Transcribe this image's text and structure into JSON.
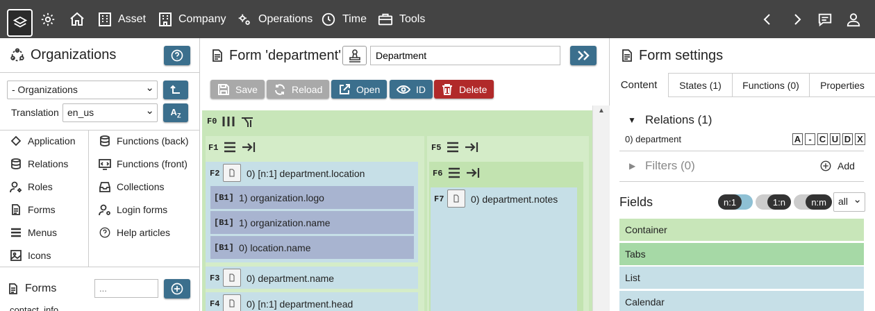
{
  "topbar": {
    "asset": "Asset",
    "company": "Company",
    "operations": "Operations",
    "time": "Time",
    "tools": "Tools"
  },
  "left": {
    "title": "Organizations",
    "select_value": "- Organizations",
    "translation_label": "Translation",
    "translation_value": "en_us",
    "menu_col1": [
      "Application",
      "Relations",
      "Roles",
      "Forms",
      "Menus",
      "Icons"
    ],
    "menu_col2": [
      "Functions (back)",
      "Functions (front)",
      "Collections",
      "Login forms",
      "Help articles"
    ],
    "bottom_title": "Forms",
    "bottom_placeholder": "...",
    "list_item": "contact_info"
  },
  "mid": {
    "title": "Form 'department'",
    "name_value": "Department",
    "buttons": {
      "save": "Save",
      "reload": "Reload",
      "open": "Open",
      "id": "ID",
      "delete": "Delete"
    },
    "f0": "F0",
    "f1": "F1",
    "f2": "F2",
    "f3": "F3",
    "f4": "F4",
    "f5": "F5",
    "f6": "F6",
    "f7": "F7",
    "b1": "[B1]",
    "f2_text": "0) [n:1] department.location",
    "b_items": [
      "1) organization.logo",
      "1) organization.name",
      "0) location.name"
    ],
    "f3_text": "0) department.name",
    "f4_text": "0) [n:1] department.head",
    "f7_text": "0) department.notes"
  },
  "right": {
    "title": "Form settings",
    "tabs": [
      "Content",
      "States (1)",
      "Functions (0)",
      "Properties"
    ],
    "relations_title": "Relations (1)",
    "relation_item": "0) department",
    "crud": [
      "A",
      "-",
      "C",
      "U",
      "D",
      "X"
    ],
    "filters_title": "Filters (0)",
    "add_label": "Add",
    "fields_title": "Fields",
    "toggles": [
      "n:1",
      "1:n",
      "n:m"
    ],
    "filter_value": "all",
    "fields": [
      "Container",
      "Tabs",
      "List",
      "Calendar"
    ]
  },
  "colors": {
    "topbar": "#444444",
    "accent": "#3b6f8d",
    "delete": "#b12a2a",
    "disabled": "#a9a9a9",
    "green": "#c8e6b9",
    "blue": "#c6dfe7",
    "purple": "#a8b4d0"
  }
}
